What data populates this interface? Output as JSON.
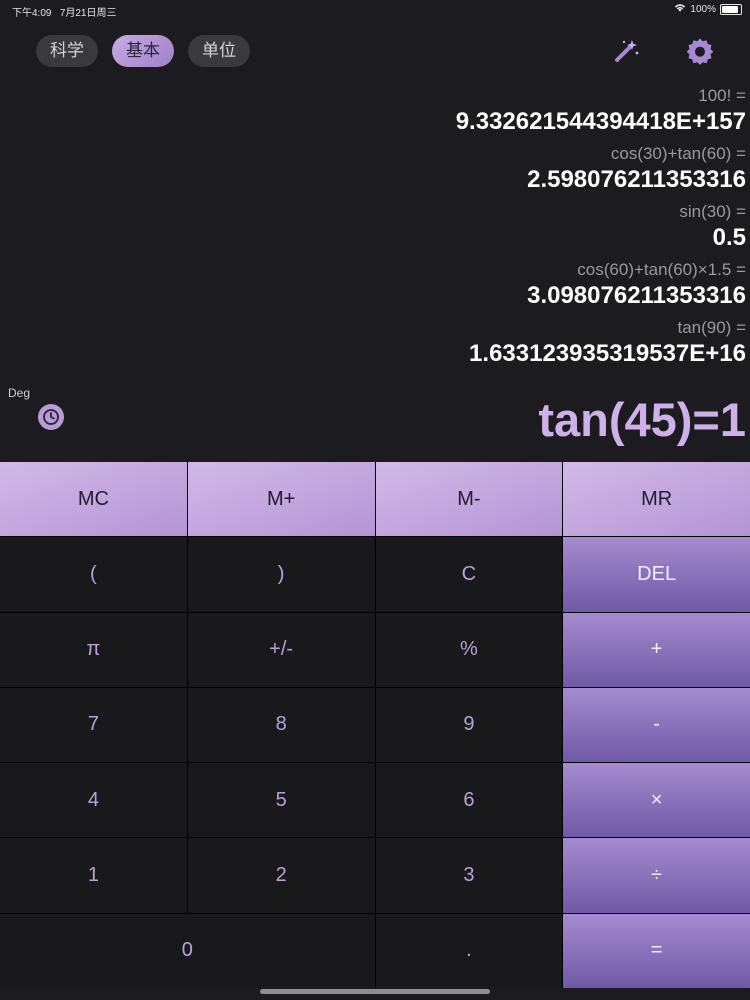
{
  "status": {
    "time": "下午4:09",
    "date": "7月21日周三",
    "battery": "100%",
    "battery_level": 1.0
  },
  "tabs": [
    {
      "label": "科学"
    },
    {
      "label": "基本"
    },
    {
      "label": "单位"
    }
  ],
  "icons": {
    "magic": "magic-wand-icon",
    "settings": "gear-icon",
    "history": "clock-icon",
    "wifi": "wifi-icon"
  },
  "history": [
    {
      "expr": "100! =",
      "result": "9.332621544394418E+157"
    },
    {
      "expr": "cos(30)+tan(60) =",
      "result": "2.598076211353316"
    },
    {
      "expr": "sin(30) =",
      "result": "0.5"
    },
    {
      "expr": "cos(60)+tan(60)×1.5 =",
      "result": "3.098076211353316"
    },
    {
      "expr": "tan(90) =",
      "result": "1.633123935319537E+16"
    }
  ],
  "angle_mode": "Deg",
  "display": "tan(45)=1",
  "keys": {
    "mc": "MC",
    "mplus": "M+",
    "mminus": "M-",
    "mr": "MR",
    "lparen": "(",
    "rparen": ")",
    "clear": "C",
    "del": "DEL",
    "pi": "π",
    "sign": "+/-",
    "percent": "%",
    "plus": "+",
    "seven": "7",
    "eight": "8",
    "nine": "9",
    "minus": "-",
    "four": "4",
    "five": "5",
    "six": "6",
    "multiply": "×",
    "one": "1",
    "two": "2",
    "three": "3",
    "divide": "÷",
    "zero": "0",
    "dot": ".",
    "equals": "="
  },
  "colors": {
    "background": "#1c1b1f",
    "accent": "#b89bd9",
    "display_text": "#cdb1e8"
  }
}
